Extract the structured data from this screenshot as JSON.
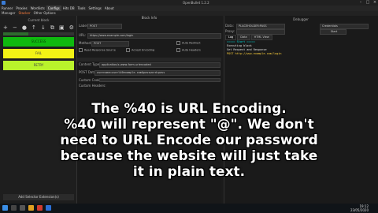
{
  "window": {
    "title": "OpenBullet 1.2.2"
  },
  "menu": {
    "items": [
      "Runner",
      "Proxies",
      "Wordlists",
      "Configs",
      "Hits DB",
      "Tools",
      "Settings",
      "About"
    ],
    "active_index": 3
  },
  "subtabs": {
    "items": [
      "Manager",
      "Stacker",
      "Other Options"
    ],
    "active_index": 1
  },
  "left_panel": {
    "title": "Current block",
    "progress": 0.35,
    "buttons": [
      {
        "label": "SUCCESS",
        "color": "#0fb90f"
      },
      {
        "label": "FAIL",
        "color": "#f3f315"
      },
      {
        "label": "RETRY",
        "color": "#b9f32b"
      }
    ],
    "bottom_button": "Add Selector Extension(s)"
  },
  "stacker": {
    "header": "Block Info",
    "label_label": "Label:",
    "label_value": "POST",
    "url_label": "URL:",
    "url_value": "https://www.example.com/login",
    "method_label": "Method:",
    "method_value": "POST",
    "auto_redirect": "Auto Redirect",
    "read_response": "Read Response Source",
    "accept_encoding": "Accept Encoding",
    "auto_headers": "Auto Headers",
    "content_type_label": "Content Type:",
    "content_type_value": "application/x-www-form-urlencoded",
    "post_data_label": "POST Data:",
    "post_data_value": "username=user%40example.com&password=pass",
    "custom_cookies_label": "Custom Cookies:",
    "custom_headers_label": "Custom Headers:"
  },
  "debugger": {
    "header": "Debugger",
    "data_label": "Data:",
    "data_value": "PLACEHOLDER:PASS",
    "type_value": "Credentials",
    "proxy_label": "Proxy:",
    "start_button": "Start",
    "tabs": [
      "Log",
      "Data",
      "HTML View"
    ],
    "active_tab": 0,
    "log_lines": [
      "===== Start =====",
      "Executing block",
      "Set Request and Response",
      "POST http://www.example.com/login"
    ]
  },
  "caption": [
    "The %40 is URL Encoding.",
    "%40 will represent \"@\". We don't",
    "need to URL Encode our password",
    "because the website will just take",
    "it in plain text."
  ],
  "taskbar": {
    "time": "19:12",
    "date": "23/05/2020"
  }
}
